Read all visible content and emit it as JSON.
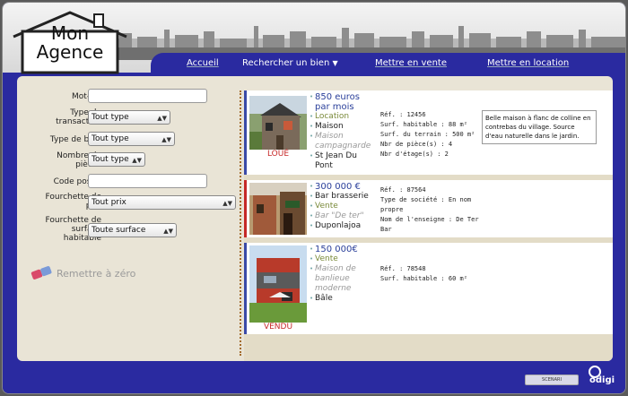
{
  "logo": {
    "line1": "Mon",
    "line2": "Agence"
  },
  "nav": {
    "items": [
      {
        "label": "Accueil"
      },
      {
        "label": "Rechercher un bien"
      },
      {
        "label": "Mettre en vente"
      },
      {
        "label": "Mettre en location"
      }
    ]
  },
  "search": {
    "keyword_label": "Mot-clé",
    "keyword_value": "",
    "transaction_label": "Type de transaction",
    "transaction_value": "Tout type",
    "property_type_label": "Type de bien",
    "property_type_value": "Tout type",
    "rooms_label": "Nombre de pièces",
    "rooms_value": "Tout type",
    "postal_label": "Code postal",
    "postal_value": "",
    "price_label": "Fourchette de prix",
    "price_value": "Tout prix",
    "surface_label": "Fourchette de surface habitable",
    "surface_value": "Toute surface",
    "reset_label": "Remettre à zéro"
  },
  "listings": [
    {
      "price": "850 euros par mois",
      "transaction": "Location",
      "type": "Maison",
      "description": "Maison campagnarde",
      "city": "St Jean Du Pont",
      "status": "LOUÉ",
      "specs": [
        "Réf. : 12456",
        "Surf. habitable : 88 m²",
        "Surf. du terrain : 500 m²",
        "Nbr de pièce(s) : 4",
        "Nbr d'étage(s) : 2"
      ],
      "note": "Belle maison à flanc de colline en contrebas du village. Source d'eau naturelle dans le jardin.",
      "bar_color": "#3a4aa8"
    },
    {
      "price": "300 000 €",
      "type": "Bar brasserie",
      "transaction": "Vente",
      "description": "Bar \"De ter\"",
      "city": "Duponlajoa",
      "status": "",
      "specs": [
        "Réf. : 87564",
        "Type de société : En nom propre",
        "Nom de l'enseigne : De Ter Bar"
      ],
      "note": "",
      "bar_color": "#c62828"
    },
    {
      "price": "150 000€",
      "transaction": "Vente",
      "description": "Maison de banlieue moderne",
      "city": "Bâle",
      "status": "VENDU",
      "specs": [
        "Réf. : 78548",
        "Surf. habitable : 60 m²"
      ],
      "note": "",
      "bar_color": "#3a4aa8"
    }
  ],
  "footer": {
    "scenari_label": "SCENARI",
    "brand_label": "odigi"
  }
}
